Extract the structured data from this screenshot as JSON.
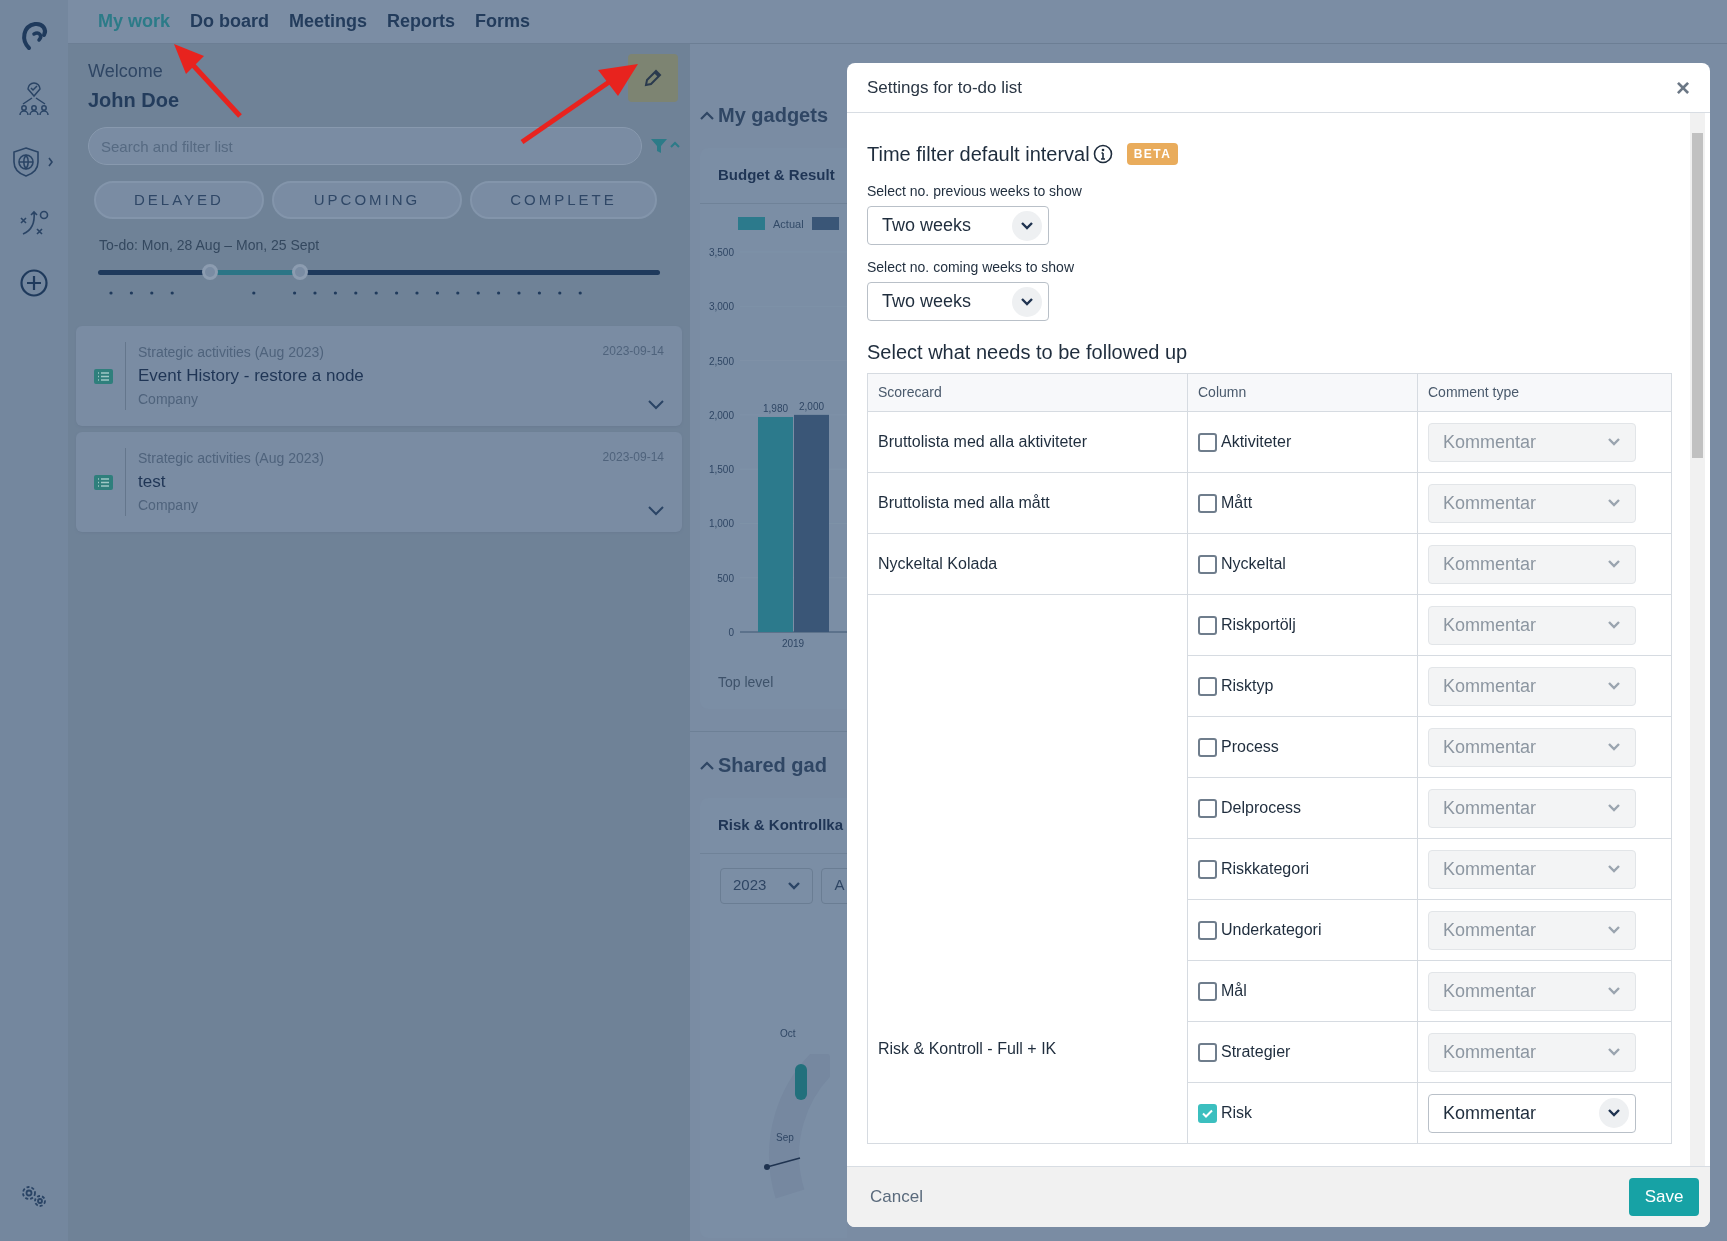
{
  "nav": {
    "tabs": [
      {
        "label": "My work",
        "selected": true
      },
      {
        "label": "Do board",
        "selected": false
      },
      {
        "label": "Meetings",
        "selected": false
      },
      {
        "label": "Reports",
        "selected": false
      },
      {
        "label": "Forms",
        "selected": false
      }
    ]
  },
  "welcome": {
    "greeting": "Welcome",
    "name": "John Doe"
  },
  "search": {
    "placeholder": "Search and filter list"
  },
  "filters": [
    "DELAYED",
    "UPCOMING",
    "COMPLETE"
  ],
  "range": {
    "label": "To-do: Mon, 28 Aug – Mon, 25 Sept",
    "thumbs": [
      {
        "level": 0.2
      },
      {
        "level": 0.36
      }
    ]
  },
  "tasks": [
    {
      "category": "Strategic activities (Aug 2023)",
      "title": "Event History - restore a node",
      "owner": "Company",
      "date": "2023-09-14"
    },
    {
      "category": "Strategic activities (Aug 2023)",
      "title": "test",
      "owner": "Company",
      "date": "2023-09-14"
    }
  ],
  "gadgets": {
    "heading": "My gadgets",
    "card": {
      "title": "Budget & Result",
      "footer": "Top level",
      "chart_data": {
        "type": "bar",
        "categories": [
          "2019"
        ],
        "series": [
          {
            "name": "Actual",
            "color": "#2c7a8c",
            "values": [
              1980
            ],
            "value_labels": [
              "1,980"
            ]
          },
          {
            "color": "#3a5677",
            "values": [
              2000
            ],
            "value_labels": [
              "2,000"
            ]
          }
        ],
        "ylim": [
          0,
          3500
        ],
        "yticks": [
          {
            "value": 0,
            "label": "0"
          },
          {
            "value": 500,
            "label": "500"
          },
          {
            "value": 1000,
            "label": "1,000"
          },
          {
            "value": 1500,
            "label": "1,500"
          },
          {
            "value": 2000,
            "label": "2,000"
          },
          {
            "value": 2500,
            "label": "2,500"
          },
          {
            "value": 3000,
            "label": "3,000"
          },
          {
            "value": 3500,
            "label": "3,500"
          }
        ]
      }
    }
  },
  "shared": {
    "heading": "Shared gad",
    "card": {
      "title": "Risk & Kontrollka",
      "selects": [
        "2023",
        "A"
      ],
      "labels": [
        "Oct",
        "Sep"
      ]
    }
  },
  "modal": {
    "title": "Settings for to-do list",
    "close": "×",
    "section_title": "Time filter default interval",
    "badge": "BETA",
    "fields": [
      {
        "label": "Select no. previous weeks to show",
        "value": "Two weeks"
      },
      {
        "label": "Select no. coming weeks to show",
        "value": "Two weeks"
      }
    ],
    "follow_title": "Select what needs to be followed up",
    "columns": [
      "Scorecard",
      "Column",
      "Comment type"
    ],
    "groups": [
      {
        "scorecard": "Bruttolista med alla aktiviteter",
        "items": [
          {
            "label": "Aktiviteter",
            "checked": false,
            "comment": "Kommentar"
          }
        ]
      },
      {
        "scorecard": "Bruttolista med alla mått",
        "items": [
          {
            "label": "Mått",
            "checked": false,
            "comment": "Kommentar"
          }
        ]
      },
      {
        "scorecard": "Nyckeltal Kolada",
        "items": [
          {
            "label": "Nyckeltal",
            "checked": false,
            "comment": "Kommentar"
          }
        ]
      },
      {
        "scorecard": "Risk & Kontroll - Full + IK",
        "items": [
          {
            "label": "Riskportölj",
            "checked": false,
            "comment": "Kommentar"
          },
          {
            "label": "Risktyp",
            "checked": false,
            "comment": "Kommentar"
          },
          {
            "label": "Process",
            "checked": false,
            "comment": "Kommentar"
          },
          {
            "label": "Delprocess",
            "checked": false,
            "comment": "Kommentar"
          },
          {
            "label": "Riskkategori",
            "checked": false,
            "comment": "Kommentar"
          },
          {
            "label": "Underkategori",
            "checked": false,
            "comment": "Kommentar"
          },
          {
            "label": "Mål",
            "checked": false,
            "comment": "Kommentar"
          },
          {
            "label": "Strategier",
            "checked": false,
            "comment": "Kommentar"
          },
          {
            "label": "Risk",
            "checked": true,
            "comment": "Kommentar"
          }
        ]
      }
    ],
    "cancel": "Cancel",
    "save": "Save"
  }
}
